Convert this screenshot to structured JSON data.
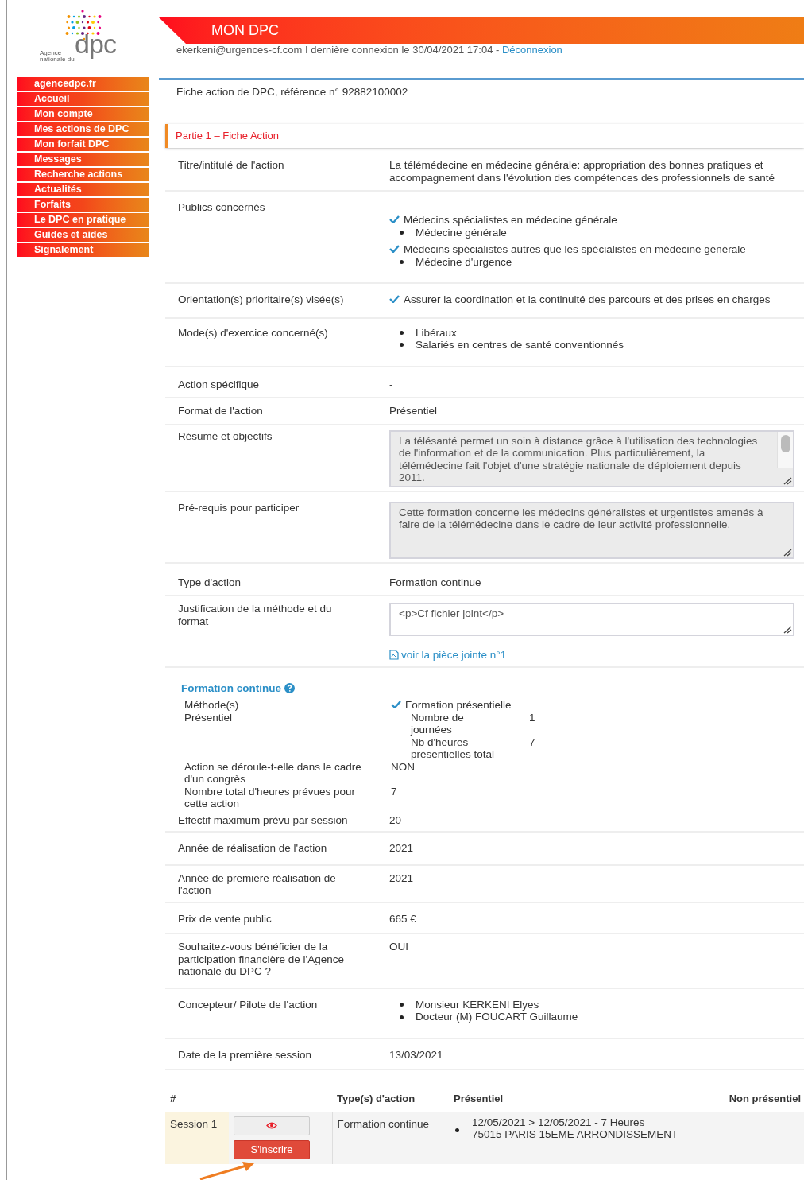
{
  "header": {
    "title": "MON DPC",
    "user_line": "ekerkeni@urgences-cf.com I dernière connexion le 30/04/2021 17:04 - ",
    "logout": "Déconnexion"
  },
  "logo": {
    "line1": "Agence",
    "line2": "nationale du",
    "mark": "dpc"
  },
  "nav": [
    {
      "label": "agencedpc.fr"
    },
    {
      "label": "Accueil"
    },
    {
      "label": "Mon compte"
    },
    {
      "label": "Mes actions de DPC"
    },
    {
      "label": "Mon forfait DPC"
    },
    {
      "label": "Messages"
    },
    {
      "label": "Recherche actions"
    },
    {
      "label": "Actualités"
    },
    {
      "label": "Forfaits"
    },
    {
      "label": "Le DPC en pratique"
    },
    {
      "label": "Guides et aides"
    },
    {
      "label": "Signalement"
    }
  ],
  "page_title": "Fiche action de DPC, référence n° 92882100002",
  "section_title": "Partie 1 – Fiche Action",
  "rows": [
    {
      "kind": "text",
      "label": "Titre/intitulé de l'action",
      "value": "La télémédecine en médecine générale: appropriation des bonnes pratiques et accompagnement dans l'évolution des compétences des professionnels de santé"
    },
    {
      "kind": "checks",
      "label": "Publics concernés",
      "items": [
        {
          "text": "Médecins spécialistes en médecine générale",
          "children": [
            "Médecine générale"
          ]
        },
        {
          "text": "Médecins spécialistes autres que les spécialistes en médecine générale",
          "children": [
            "Médecine d'urgence"
          ]
        }
      ]
    },
    {
      "kind": "checks",
      "label": "Orientation(s) prioritaire(s) visée(s)",
      "items": [
        {
          "text": "Assurer la coordination et la continuité des parcours et des prises en charges"
        }
      ]
    },
    {
      "kind": "bullets",
      "label": "Mode(s) d'exercice concerné(s)",
      "items": [
        "Libéraux",
        "Salariés en centres de santé conventionnés"
      ]
    },
    {
      "kind": "text",
      "label": "Action spécifique",
      "value": "-"
    },
    {
      "kind": "text",
      "label": "Format de l'action",
      "value": "Présentiel"
    },
    {
      "kind": "textarea",
      "label": "Résumé et objectifs",
      "value": "La télésanté permet un soin à distance grâce à l'utilisation des technologies de l'information et de la communication. Plus particulièrement, la télémédecine fait l'objet d'une stratégie nationale de déploiement depuis 2011.",
      "scrollbar": true,
      "readonly": true
    },
    {
      "kind": "textarea",
      "label": "Pré-requis pour participer",
      "value": "Cette formation concerne les médecins généralistes et urgentistes amenés à faire de la télémédecine dans le cadre de leur activité professionnelle.",
      "scrollbar": false,
      "readonly": true
    },
    {
      "kind": "text",
      "label": "Type d'action",
      "value": "Formation continue"
    },
    {
      "kind": "textarea",
      "label": "Justification de la méthode et du format",
      "value": "<p>Cf fichier joint</p>",
      "scrollbar": false,
      "readonly": false,
      "link": "voir la pièce jointe n°1"
    }
  ],
  "formation": {
    "title": "Formation continue",
    "method_label": "Méthode(s)",
    "method_sublabel": "Présentiel",
    "method_value": "Formation présentielle",
    "details": [
      {
        "label": "Nombre de journées",
        "value": "1"
      },
      {
        "label": "Nb d'heures présentielles total",
        "value": "7"
      }
    ],
    "rows": [
      {
        "label": "Action se déroule-t-elle dans le cadre d'un congrès",
        "value": "NON"
      },
      {
        "label": "Nombre total d'heures prévues pour cette action",
        "value": "7"
      }
    ],
    "effectif_label": "Effectif maximum prévu par session",
    "effectif_value": "20"
  },
  "rows2": [
    {
      "kind": "text",
      "label": "Année de réalisation de l'action",
      "value": "2021"
    },
    {
      "kind": "text",
      "label": "Année de première réalisation de l'action",
      "value": "2021"
    },
    {
      "kind": "text",
      "label": "Prix de vente public",
      "value": "665 €"
    },
    {
      "kind": "text",
      "label": "Souhaitez-vous bénéficier de la participation financière de l'Agence nationale du DPC ?",
      "value": "OUI"
    },
    {
      "kind": "bullets",
      "label": "Concepteur/ Pilote de l'action",
      "items": [
        "Monsieur KERKENI Elyes",
        "Docteur (M) FOUCART Guillaume"
      ]
    },
    {
      "kind": "text",
      "label": "Date de la première session",
      "value": "13/03/2021"
    }
  ],
  "sessions": {
    "columns": [
      "#",
      "Type(s) d'action",
      "Présentiel",
      "Non présentiel"
    ],
    "rows": [
      {
        "name": "Session 1",
        "type": "Formation continue",
        "presentiel": [
          "12/05/2021 > 12/05/2021 - 7 Heures",
          "75015 PARIS 15EME ARRONDISSEMENT"
        ],
        "button": "S'inscrire"
      }
    ]
  }
}
